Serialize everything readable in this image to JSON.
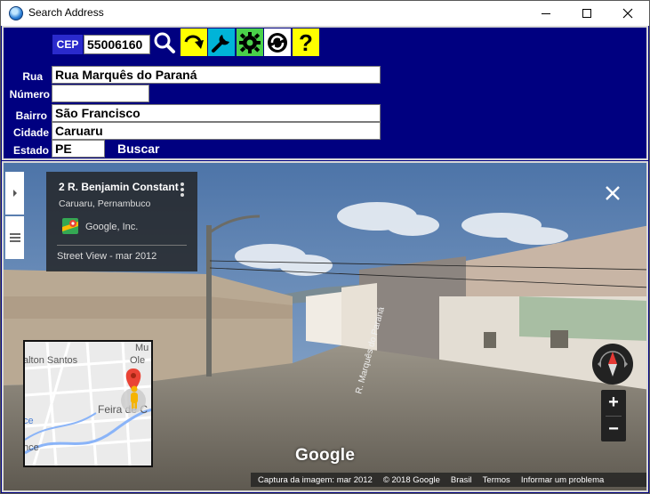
{
  "window": {
    "title": "Search Address"
  },
  "form": {
    "cep_label": "CEP",
    "cep_value": "55006160",
    "rua_label": "Rua",
    "rua_value": "Rua Marquês do Paraná",
    "numero_label": "Número",
    "numero_value": "",
    "bairro_label": "Bairro",
    "bairro_value": "São Francisco",
    "cidade_label": "Cidade",
    "cidade_value": "Caruaru",
    "estado_label": "Estado",
    "estado_value": "PE",
    "buscar_label": "Buscar"
  },
  "toolbar": {
    "icons": [
      "search-icon",
      "redo-icon",
      "wrench-icon",
      "gear-icon",
      "refresh-icon",
      "help-icon"
    ],
    "help_glyph": "?"
  },
  "streetview": {
    "card_title": "2 R. Benjamin Constant",
    "card_subtitle": "Caruaru, Pernambuco",
    "card_author": "Google, Inc.",
    "card_date": "Street View - mar 2012",
    "street_sign": "R. Marquês do Paraná",
    "google_logo": "Google",
    "map_labels": [
      "Mu",
      "Ole",
      "alton Santos",
      "Feira de C",
      "ce",
      "nce"
    ],
    "footer": {
      "capture": "Captura da imagem: mar 2012",
      "copyright": "© 2018 Google",
      "country": "Brasil",
      "terms": "Termos",
      "report": "Informar um problema"
    },
    "zoom_in": "+",
    "zoom_out": "−"
  },
  "colors": {
    "form_bg": "#000080",
    "cep_label_bg": "#2a2acc",
    "redo_bg": "#ffff00",
    "wrench_bg": "#00b4d8",
    "gear_bg": "#4ad14a",
    "help_bg": "#ffff00"
  }
}
